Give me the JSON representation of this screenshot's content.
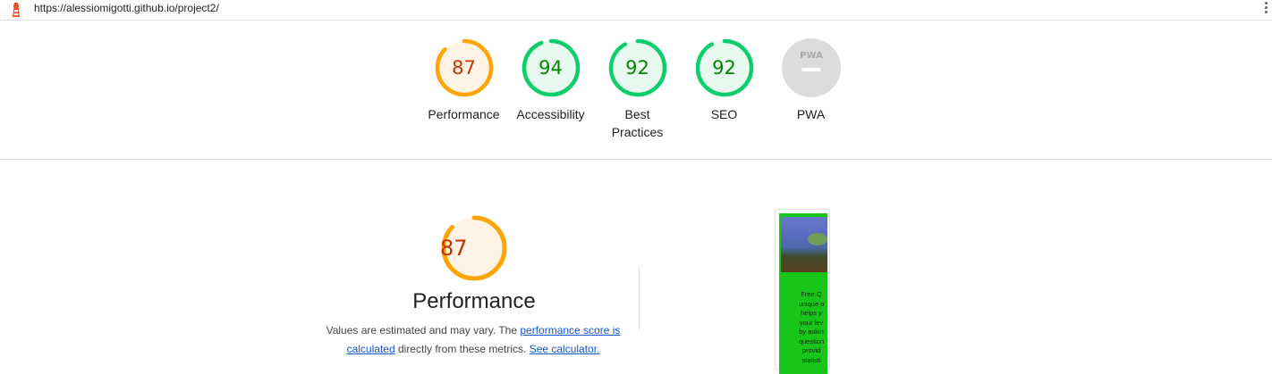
{
  "url_bar": {
    "url": "https://alessiomigotti.github.io/project2/"
  },
  "colors": {
    "average": "#ffa400",
    "average_text": "#c33300",
    "average_bg": "#fff3e5",
    "pass": "#0cce6b",
    "pass_text": "#008800",
    "pass_bg": "#e8f9ef",
    "pwa_bg": "#dcdcdc",
    "link": "#1155cc"
  },
  "gauges": [
    {
      "score": "87",
      "value": 0.87,
      "label": "Performance",
      "status": "average"
    },
    {
      "score": "94",
      "value": 0.94,
      "label": "Accessibility",
      "status": "pass"
    },
    {
      "score": "92",
      "value": 0.92,
      "label": "Best Practices",
      "status": "pass"
    },
    {
      "score": "92",
      "value": 0.92,
      "label": "SEO",
      "status": "pass"
    },
    {
      "score": "",
      "value": 0,
      "label": "PWA",
      "status": "pwa",
      "badge": "PWA"
    }
  ],
  "performance_section": {
    "score": "87",
    "value": 0.87,
    "title": "Performance",
    "desc_prefix": "Values are estimated and may vary. The ",
    "link1": "performance score is calculated",
    "desc_middle": " directly from these metrics. ",
    "link2": "See calculator."
  },
  "thumbnail": {
    "text": "Free Q\nunique o\nhelps y\nyour lev\nby askin\nquestion\nprovid\nstatisti"
  }
}
